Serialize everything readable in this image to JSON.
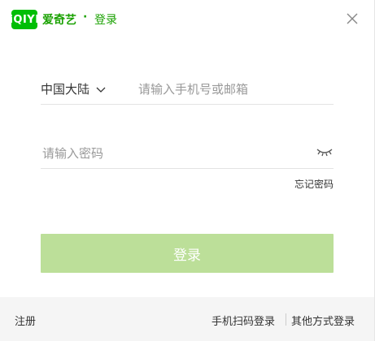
{
  "header": {
    "logo_text": "iQIYI",
    "brand": "爱奇艺",
    "separator": "·",
    "title": "登录"
  },
  "phone_row": {
    "region": "中国大陆",
    "placeholder": "请输入手机号或邮箱",
    "value": ""
  },
  "password_row": {
    "placeholder": "请输入密码",
    "value": ""
  },
  "forgot_password": "忘记密码",
  "login_button": "登录",
  "footer": {
    "register": "注册",
    "qr_login": "手机扫码登录",
    "other_login": "其他方式登录"
  },
  "colors": {
    "brand_green": "#00be06",
    "title_green": "#19a100",
    "button_disabled": "#bcdf99",
    "footer_bg": "#f5f5f5"
  },
  "icons": {
    "close": "close-icon",
    "dropdown": "chevron-down-icon",
    "eye": "eye-closed-icon"
  }
}
